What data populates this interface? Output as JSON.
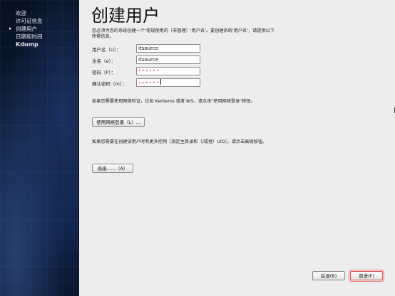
{
  "sidebar": {
    "items": [
      {
        "label": "欢迎"
      },
      {
        "label": "许可证信息"
      },
      {
        "label": "创建用户"
      },
      {
        "label": "日期和时间"
      },
      {
        "label": "Kdump"
      }
    ],
    "current_index": 2
  },
  "page": {
    "title": "创建用户",
    "intro": "您必须为您的系统创建一个'常规使用的（非管理）'用户名'。要创建系统'用户名'，请提供以下所需信息。"
  },
  "form": {
    "username": {
      "label": "用户名（U）：",
      "value": "itsource"
    },
    "fullname": {
      "label": "全名（e）：",
      "value": "itsource"
    },
    "password": {
      "label": "密码（P）：",
      "value": "••••••"
    },
    "confirm": {
      "label": "确认密码（m）：",
      "value": "••••••"
    }
  },
  "network": {
    "text": "如果您需要使用网络验证，比如 Kerberos 或者 NIS，请点击\"使用网络登录\"按钮。",
    "button": "使用网络登录（L）..."
  },
  "advanced": {
    "text": "如果您需要在创建该用户时有更多控制［指定主目录和（/或者）UID］，请点击高级按钮。",
    "button": "高级......（A）"
  },
  "footer": {
    "back": "后退(B)",
    "forward": "前进(F)"
  },
  "colors": {
    "sidebar_dark": "#07101f",
    "sidebar_blue": "#1c3160",
    "highlight_red": "#d9534f",
    "content_bg": "#ededed"
  }
}
